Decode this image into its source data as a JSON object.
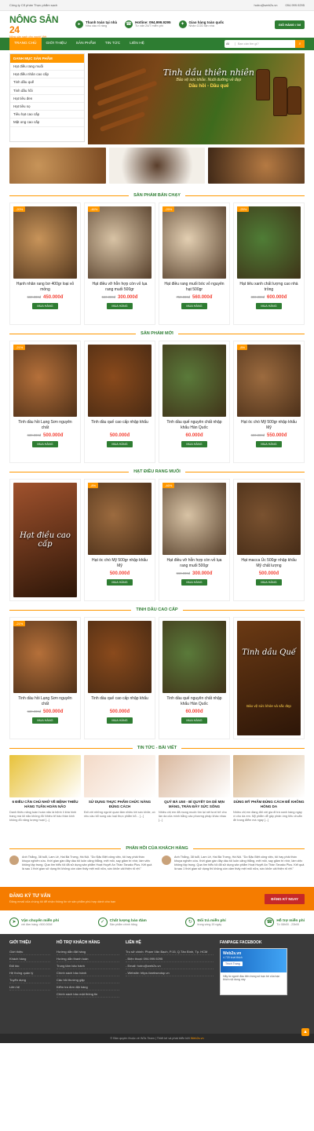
{
  "topbar": {
    "company": "Công ty Cổ phần Thực phẩm sạch",
    "email": "hotro@web2s.vn",
    "phone": "094.999.9295"
  },
  "logo": {
    "name_a": "NÔNG SẢN",
    "name_b": "24",
    "tag": "Nông sản sạch cho người Việt",
    "badge": "Sale"
  },
  "header_info": [
    {
      "icon": "truck-icon",
      "t1": "Thanh toán tại nhà",
      "t2": "Nhu cầu rõ ràng"
    },
    {
      "icon": "phone-icon",
      "t1": "Hotline: 094.999.9295",
      "t2": "Tư vấn 24/7 miễn phí"
    },
    {
      "icon": "gift-icon",
      "t1": "Giao hàng toàn quốc",
      "t2": "Nhận COD tận nhà"
    }
  ],
  "cart_label": "GIỎ HÀNG / 0đ",
  "nav": [
    "TRANG CHỦ",
    "GIỚI THIỆU",
    "SẢN PHẨM",
    "TIN TỨC",
    "LIÊN HỆ"
  ],
  "search": {
    "select": "All",
    "placeholder": "Bạn cần tìm gì?"
  },
  "sidemenu": {
    "title": "DANH MỤC SẢN PHẨM",
    "items": [
      "Hạt điều rang muối",
      "Hạt điều nhân cao cấp",
      "Tinh dầu quế",
      "Tinh dầu hồi",
      "Hạt tiêu đen",
      "Hạt tiêu sọ",
      "Tiêu hạt cao cấp",
      "Mật ong cao cấp"
    ]
  },
  "banner": {
    "line1": "Tinh dầu thiên nhiên",
    "line2": "Bảo vệ sức khỏe. Nuôi dưỡng vẻ đẹp",
    "line3": "Dầu hồi - Dầu quế"
  },
  "sections": [
    {
      "title": "SẢN PHẨM BÁN CHẠY",
      "products": [
        {
          "badge": "-20%",
          "name": "Hạnh nhân rang bơ 400gr loại vỏ mỏng",
          "old": "560.000đ",
          "new": "450.000đ",
          "buy": "MUA HÀNG",
          "color": "#c8945a"
        },
        {
          "badge": "-46%",
          "name": "Hạt điều vỡ hỗn hợp còn vỏ lụa rang muối 500gr",
          "old": "560.000đ",
          "new": "300.000đ",
          "buy": "MUA HÀNG",
          "color": "#d8c3a5"
        },
        {
          "badge": "-25%",
          "name": "Hạt điều rang muối bóc vỏ nguyên hạt 500gr",
          "old": "750.000đ",
          "new": "560.000đ",
          "buy": "MUA HÀNG",
          "color": "#e3cfb2"
        },
        {
          "badge": "-25%",
          "name": "Hạt tiêu xanh chất lượng cao nhà trồng",
          "old": "800.000đ",
          "new": "600.000đ",
          "buy": "MUA HÀNG",
          "color": "#4f7d36"
        }
      ]
    },
    {
      "title": "SẢN PHẨM MỚI",
      "products": [
        {
          "badge": "-21%",
          "name": "Tinh dầu hồi Lạng Sơn nguyên chất",
          "old": "630.000đ",
          "new": "500.000đ",
          "buy": "MUA HÀNG",
          "color": "#b5703a"
        },
        {
          "badge": "",
          "name": "Tinh dầu quế cao cấp nhập khẩu",
          "old": "",
          "new": "500.000đ",
          "buy": "MUA HÀNG",
          "color": "#8a4a1c"
        },
        {
          "badge": "",
          "name": "Tinh dầu quế nguyên chất nhập khẩu Hàn Quốc",
          "old": "",
          "new": "60.000đ",
          "buy": "MUA HÀNG",
          "color": "#5a7a3a"
        },
        {
          "badge": "-8%",
          "name": "Hạt óc chó Mỹ 500gr nhập khẩu Mỹ",
          "old": "600.000đ",
          "new": "550.000đ",
          "buy": "MUA HÀNG",
          "color": "#9c6b3f"
        }
      ]
    },
    {
      "title": "HẠT ĐIỀU RANG MUỐI",
      "products": [
        {
          "badge": "",
          "name": "",
          "old": "",
          "new": "",
          "buy": "",
          "color": "#a0522d",
          "promo": "Hạt điều cao cấp"
        },
        {
          "badge": "-8%",
          "name": "Hạt óc chó Mỹ 500gr nhập khẩu Mỹ",
          "old": "",
          "new": "500.000đ",
          "buy": "MUA HÀNG",
          "color": "#9c6b3f"
        },
        {
          "badge": "-46%",
          "name": "Hạt điều vỡ hỗn hợp còn vỏ lụa rang muối 500gr",
          "old": "560.000đ",
          "new": "300.000đ",
          "buy": "MUA HÀNG",
          "color": "#d8c3a5"
        },
        {
          "badge": "",
          "name": "Hạt macca Úc 500gr nhập khẩu Mỹ chất lượng",
          "old": "",
          "new": "500.000đ",
          "buy": "MUA HÀNG",
          "color": "#7a5230"
        }
      ]
    },
    {
      "title": "TINH DẦU CAO CẤP",
      "products": [
        {
          "badge": "-21%",
          "name": "Tinh dầu hồi Lạng Sơn nguyên chất",
          "old": "630.000đ",
          "new": "500.000đ",
          "buy": "MUA HÀNG",
          "color": "#b5703a"
        },
        {
          "badge": "",
          "name": "Tinh dầu quế cao cấp nhập khẩu",
          "old": "",
          "new": "500.000đ",
          "buy": "MUA HÀNG",
          "color": "#8a4a1c"
        },
        {
          "badge": "",
          "name": "Tinh dầu quế nguyên chất nhập khẩu Hàn Quốc",
          "old": "",
          "new": "60.000đ",
          "buy": "MUA HÀNG",
          "color": "#5a7a3a"
        },
        {
          "badge": "",
          "name": "",
          "old": "",
          "new": "",
          "buy": "",
          "color": "#6b3a14",
          "promo": "Tinh dầu Quế",
          "promo2": "Bảo vệ sức khỏe và sắc đẹp"
        }
      ]
    }
  ],
  "news": {
    "title": "TIN TỨC - BÀI VIẾT",
    "items": [
      {
        "title": "6 ĐIỀU CẦN CHÚ NHỚ VỀ BỆNH THIẾU HÀNG TUẦN HOÀN NÃO",
        "desc": "Danh thiếu năng tuần hoàn não là bệnh lí khá hình trang mà lối não không đủ Nhiều tế bào thần kinh không đủ năng lượng hoạt [...]",
        "color": "#e8c23a"
      },
      {
        "title": "SỬ DỤNG THỰC PHẨM CHỨC NĂNG ĐÚNG CÁCH",
        "desc": "Đối với những người quan tâm nhiều tới sức khỏe, có nhu cầu bổ sung các loại thực phẩm bổ... [...]",
        "color": "#f3d9c6"
      },
      {
        "title": "QUÝ BÀ U50 - BÍ QUYẾT DA DẺ MỊN MÀNG, TRÀN ĐẦY SỨC SỐNG",
        "desc": "Nhiều chị em đã mong muốn tìm lại nét tươi trẻ cho làn da của mình bằng các phương pháp khác nhau [...]",
        "color": "#d9b79c"
      },
      {
        "title": "DÙNG MỸ PHẨM ĐÚNG CÁCH ĐỂ KHÔNG HỎNG DA",
        "desc": "Nhiều chị em đang đối với gia đi trà xanh hàng ngày vì cho da em. Mỹ phẩm dễ gây phản ứng tiêu chuẩn đề trang điểm mà ngay [...]",
        "color": "#d5b38a"
      }
    ]
  },
  "testimonials": {
    "title": "PHẢN HỒI CỦA KHÁCH HÀNG",
    "items": [
      {
        "text": "Anh Thắng, 38 tuổi, Lam Lê, Hai Bà Trưng, Hà Nội. \"Do Đặc Biệt công việc, tôi hay phải thức khuya nghiên cứu. thời gian gần đây dầu tôi luôn căng thẳng, mệt mỏi, say giảm trí nhớ, làm việc không tập trung. Qua tìm hiểu tôi đã sử dụng sản phẩm Hoạt Huyết An Thần Tanako Plus. Kết quả là sau 1 thời gian sử dụng thì không còn cảm thấy mệt mỏi nữa, sức khỏe cải thiện rõ rệt.\""
      },
      {
        "text": "Anh Thắng, 38 tuổi, Lam Lê, Hai Bà Trưng, Hà Nội. \"Do Đặc Biệt công việc, tôi hay phải thức khuya nghiên cứu. thời gian gần đây dầu tôi luôn căng thẳng, mệt mỏi, say giảm trí nhớ, làm việc không tập trung. Qua tìm hiểu tôi đã sử dụng sản phẩm Hoạt Huyết An Thần Tanako Plus. Kết quả là sau 1 thời gian sử dụng thì không còn cảm thấy mệt mỏi nữa, sức khỏe cải thiện rõ rệt.\""
      }
    ]
  },
  "signup": {
    "title": "ĐĂNG KÝ TƯ VẤN",
    "sub": "Đăng email của chúng tôi để nhận thông tin về sản phẩm phù hợp dành cho bạn",
    "button": "ĐĂNG KÝ NGAY"
  },
  "policies": [
    {
      "icon": "truck-icon",
      "a": "Vận chuyển miễn phí",
      "b": "với đơn hàng >500.000đ"
    },
    {
      "icon": "check-icon",
      "a": "Chất lượng bảo đảm",
      "b": "Sản phẩm chính hãng"
    },
    {
      "icon": "refresh-icon",
      "a": "Đổi trả miễn phí",
      "b": "trong vòng 15 ngày"
    },
    {
      "icon": "phone-icon",
      "a": "Hỗ trợ miễn phí",
      "b": "Từ 08h00 - 23h00"
    }
  ],
  "footer": {
    "col1": {
      "title": "GIỚI THIỆU",
      "items": [
        "Giới thiệu",
        "Khách hàng",
        "Đối tác",
        "Hệ thống quản lý",
        "Tuyển dụng",
        "Liên hệ"
      ]
    },
    "col2": {
      "title": "HỖ TRỢ KHÁCH HÀNG",
      "items": [
        "Hướng dẫn đặt hàng",
        "Hướng dẫn thanh toán",
        "Trung tâm bảo hành",
        "Chính sách bảo hành",
        "Câu hỏi thường gặp",
        "Kiểm tra đơn đặt hàng",
        "Chính sách bảo mật thông tin"
      ]
    },
    "col3": {
      "title": "LIÊN HỆ",
      "lines": [
        "Trụ sở chính: Phạm Văn Bạch, P.15, Q.Tân Bình, Tp. HCM",
        "- Điện thoại: 094.999.9295",
        "- Email: hotro@web2s.vn",
        "- Website: https://webseotop.vn"
      ]
    },
    "col4": {
      "title": "FANPAGE FACEBOOK",
      "fb_name": "Web2s.vn",
      "fb_likes": "4.720 lượt thích",
      "fb_btn": "Thích Trang",
      "fb_note": "Hãy là người đầu tiên trong số bạn bè của bạn thích nội dung này"
    }
  },
  "copyright": {
    "text": "© Bản quyền thuộc về W2s Team | Thiết kế và phát triển bởi ",
    "brand": "Web2s.vn"
  }
}
